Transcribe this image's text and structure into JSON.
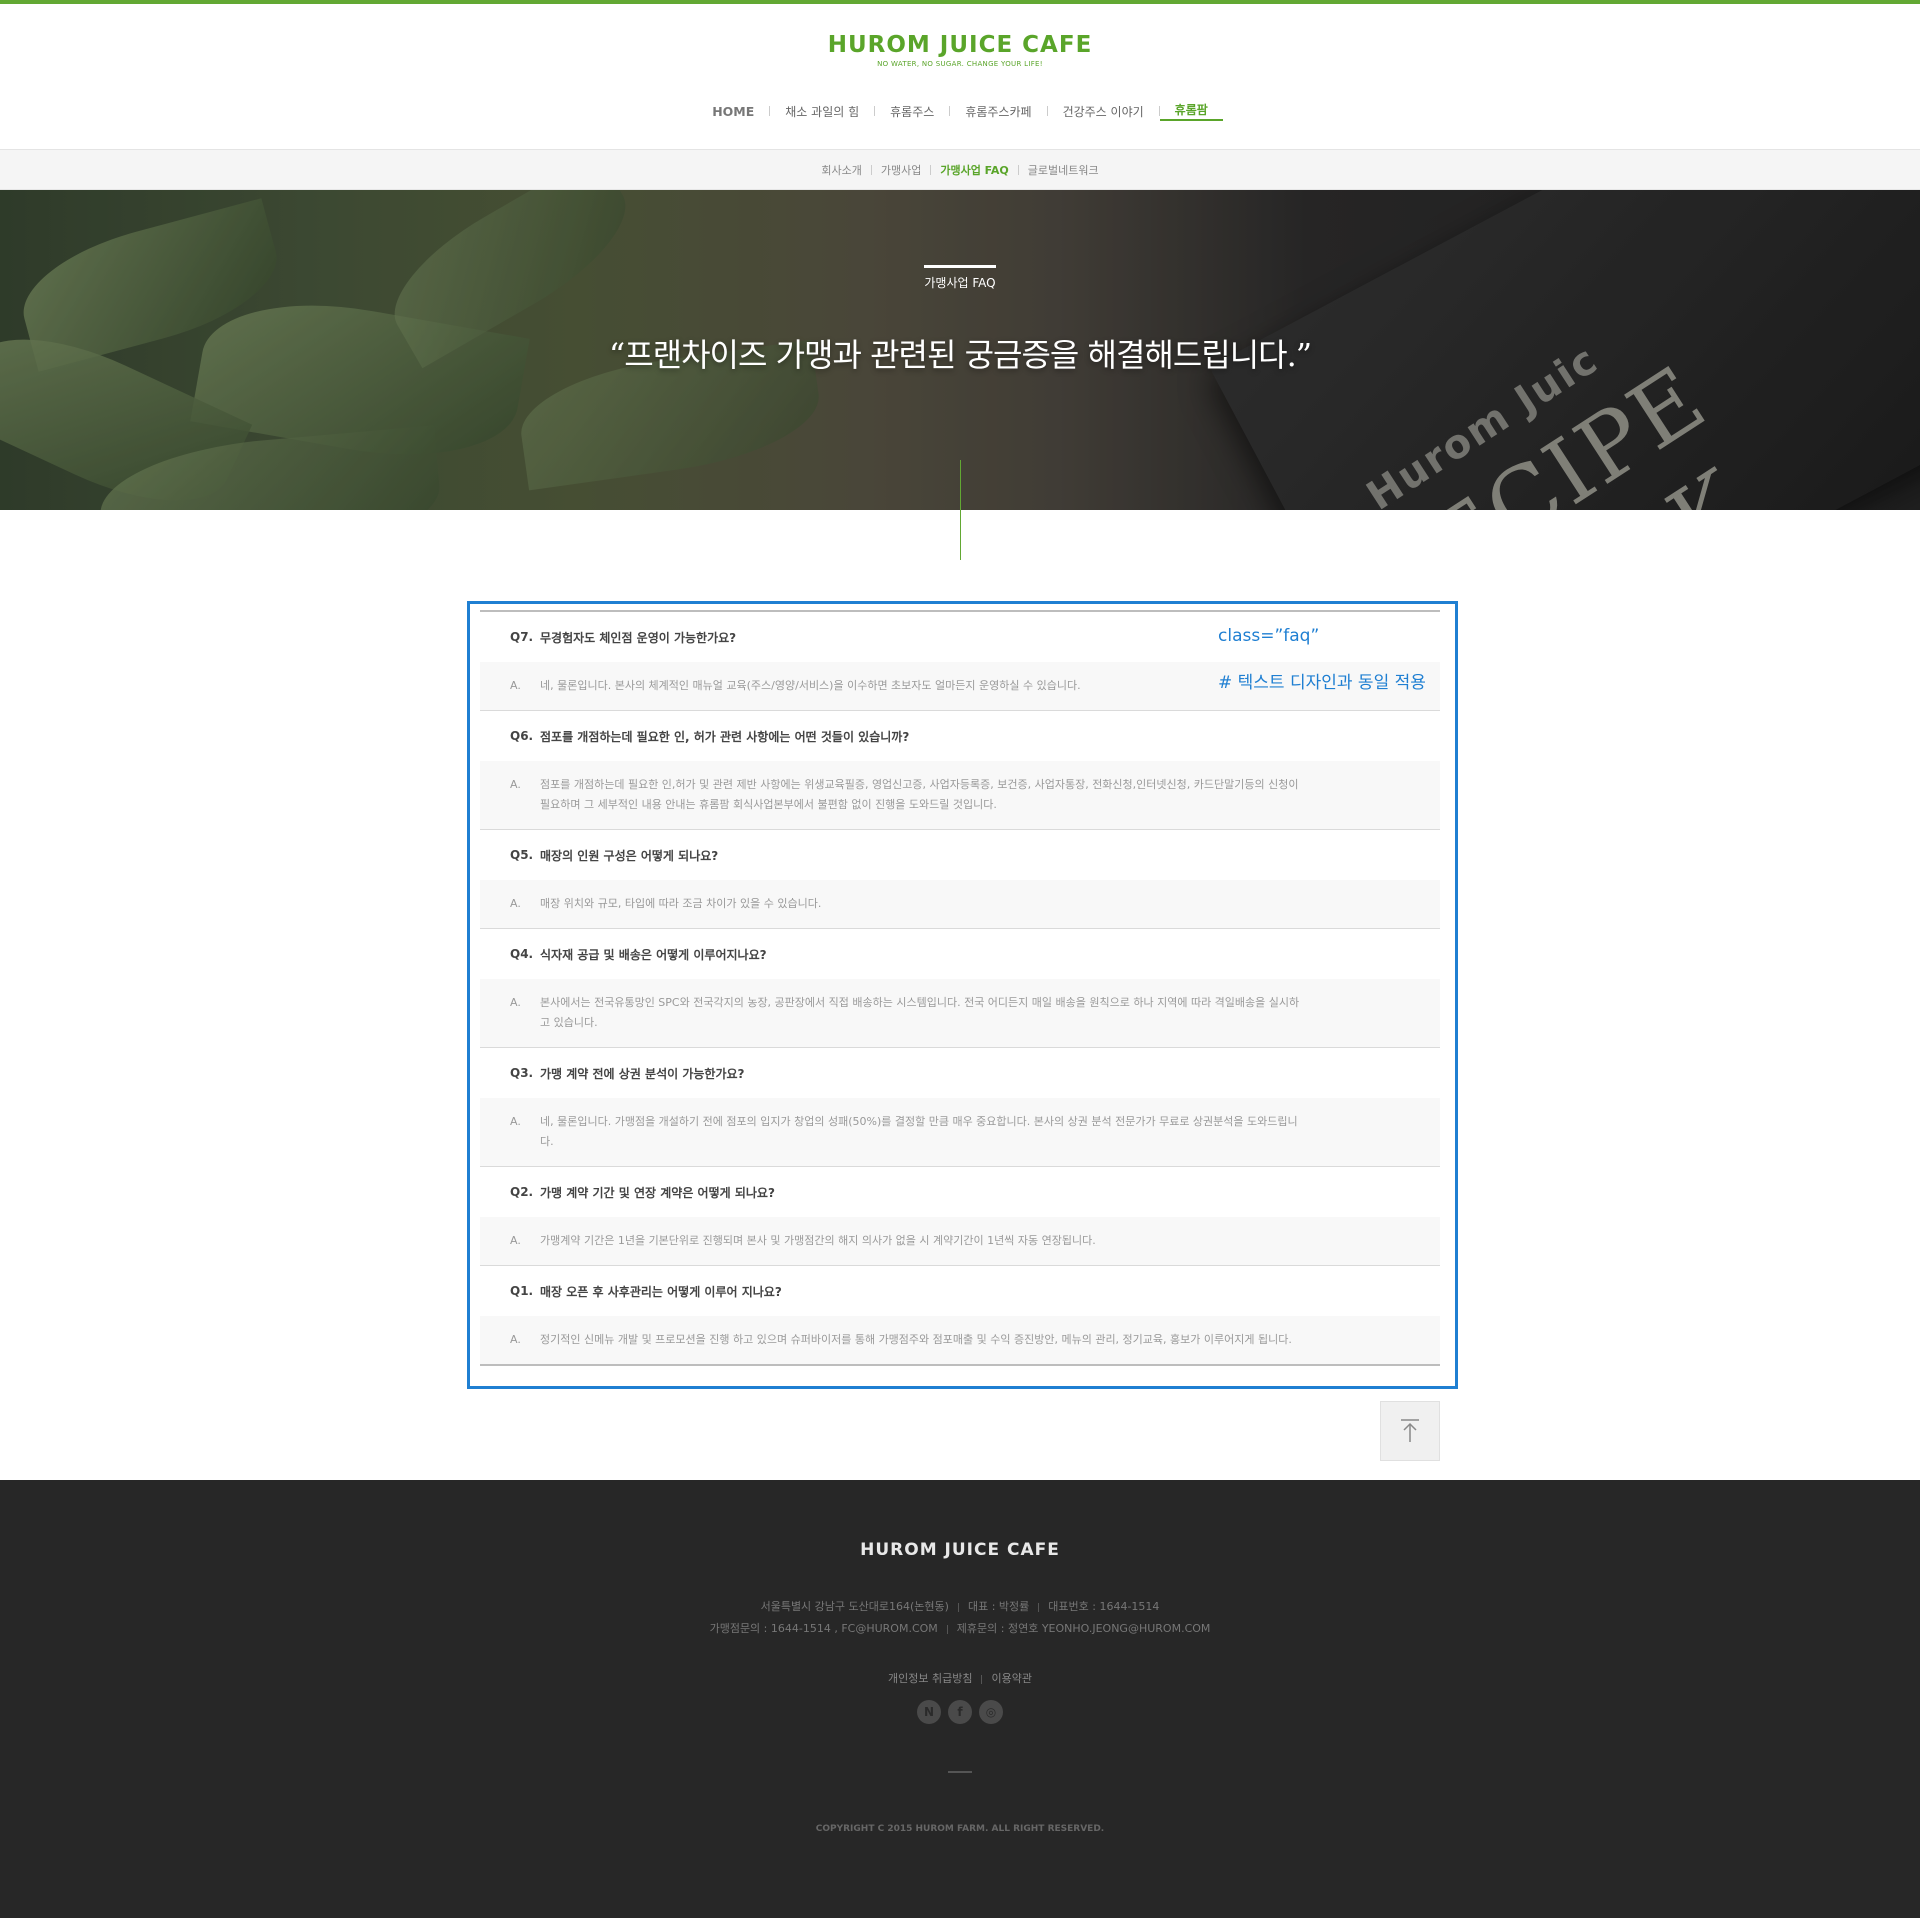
{
  "header": {
    "logo": "HUROM JUICE CAFE",
    "tagline": "NO WATER, NO SUGAR. CHANGE YOUR LIFE!",
    "nav": [
      "HOME",
      "채소 과일의 힘",
      "휴롬주스",
      "휴롬주스카페",
      "건강주스 이야기",
      "휴롬팜"
    ]
  },
  "subnav": [
    "회사소개",
    "가맹사업",
    "가맹사업 FAQ",
    "글로벌네트워크"
  ],
  "hero": {
    "label": "가맹사업 FAQ",
    "title": "“프랜차이즈 가맹과 관련된 궁금증을 해결해드립니다.”",
    "book_brand": "Hurom Juic",
    "book_line1": "RECIPE",
    "book_line2": "BOOK"
  },
  "annotations": {
    "class_note": "class=”faq”",
    "design_note": "# 텍스트 디자인과 동일 적용"
  },
  "faq": [
    {
      "q_num": "Q7.",
      "question": "무경험자도 체인점 운영이 가능한가요?",
      "a_num": "A.",
      "answer": "네, 물론입니다. 본사의 체계적인 매뉴얼 교육(주스/영양/서비스)을 이수하면 초보자도 얼마든지 운영하실 수 있습니다."
    },
    {
      "q_num": "Q6.",
      "question": "점포를 개점하는데 필요한 인, 허가 관련 사항에는 어떤 것들이 있습니까?",
      "a_num": "A.",
      "answer": "점포를 개점하는데 필요한 인,허가 및 관련 제반 사항에는 위생교육필증, 영업신고증, 사업자등록증, 보건증, 사업자통장, 전화신청,인터넷신청, 카드단말기등의 신청이 필요하며 그 세부적인 내용 안내는 휴롬팜 회식사업본부에서 불편함 없이 진행을 도와드릴 것입니다."
    },
    {
      "q_num": "Q5.",
      "question": "매장의 인원 구성은 어떻게 되나요?",
      "a_num": "A.",
      "answer": "매장 위치와 규모, 타입에 따라 조금 차이가 있을 수 있습니다."
    },
    {
      "q_num": "Q4.",
      "question": "식자재 공급 및 배송은 어떻게 이루어지나요?",
      "a_num": "A.",
      "answer": "본사에서는 전국유통망인 SPC와 전국각지의 농장, 공판장에서 직접 배송하는 시스템입니다. 전국 어디든지 매일 배송을 원칙으로 하나 지역에 따라 격일배송을 실시하고 있습니다."
    },
    {
      "q_num": "Q3.",
      "question": "가맹 계약 전에 상권 분석이 가능한가요?",
      "a_num": "A.",
      "answer": "네, 물론입니다. 가맹점을 개설하기 전에 점포의 입지가 창업의 성패(50%)를 결정할 만큼 매우 중요합니다. 본사의 상권 분석 전문가가 무료로 상권분석을 도와드립니다."
    },
    {
      "q_num": "Q2.",
      "question": "가맹 계약 기간 및 연장 계약은 어떻게 되나요?",
      "a_num": "A.",
      "answer": "가맹계약 기간은 1년을 기본단위로 진행되며 본사 및 가맹점간의 해지 의사가 없을 시 계약기간이 1년씩 자동 연장됩니다."
    },
    {
      "q_num": "Q1.",
      "question": "매장 오픈 후 사후관리는 어떻게 이루어 지나요?",
      "a_num": "A.",
      "answer": "정기적인 신메뉴 개발 및 프로모션을 진행 하고 있으며 슈퍼바이저를 통해 가맹점주와 점포매출 및 수익 증진방안, 메뉴의 관리, 정기교육, 홍보가 이루어지게 됩니다."
    }
  ],
  "footer": {
    "logo": "HUROM JUICE CAFE",
    "address": "서울특별시 강남구 도산대로164(논현동)",
    "ceo": "대표 : 박정률",
    "phone": "대표번호 : 1644-1514",
    "franchise": "가맹점문의 : 1644-1514 , FC@HUROM.COM",
    "partner": "제휴문의 : 정연호 YEONHO.JEONG@HUROM.COM",
    "privacy": "개인정보 취급방침",
    "terms": "이용약관",
    "sns": [
      "N",
      "f",
      "◎"
    ],
    "copyright": "COPYRIGHT C 2015 HUROM FARM. ALL RIGHT RESERVED."
  },
  "colors": {
    "accent": "#62a833",
    "annotation": "#1f7fd2",
    "footer_bg": "#272727"
  }
}
